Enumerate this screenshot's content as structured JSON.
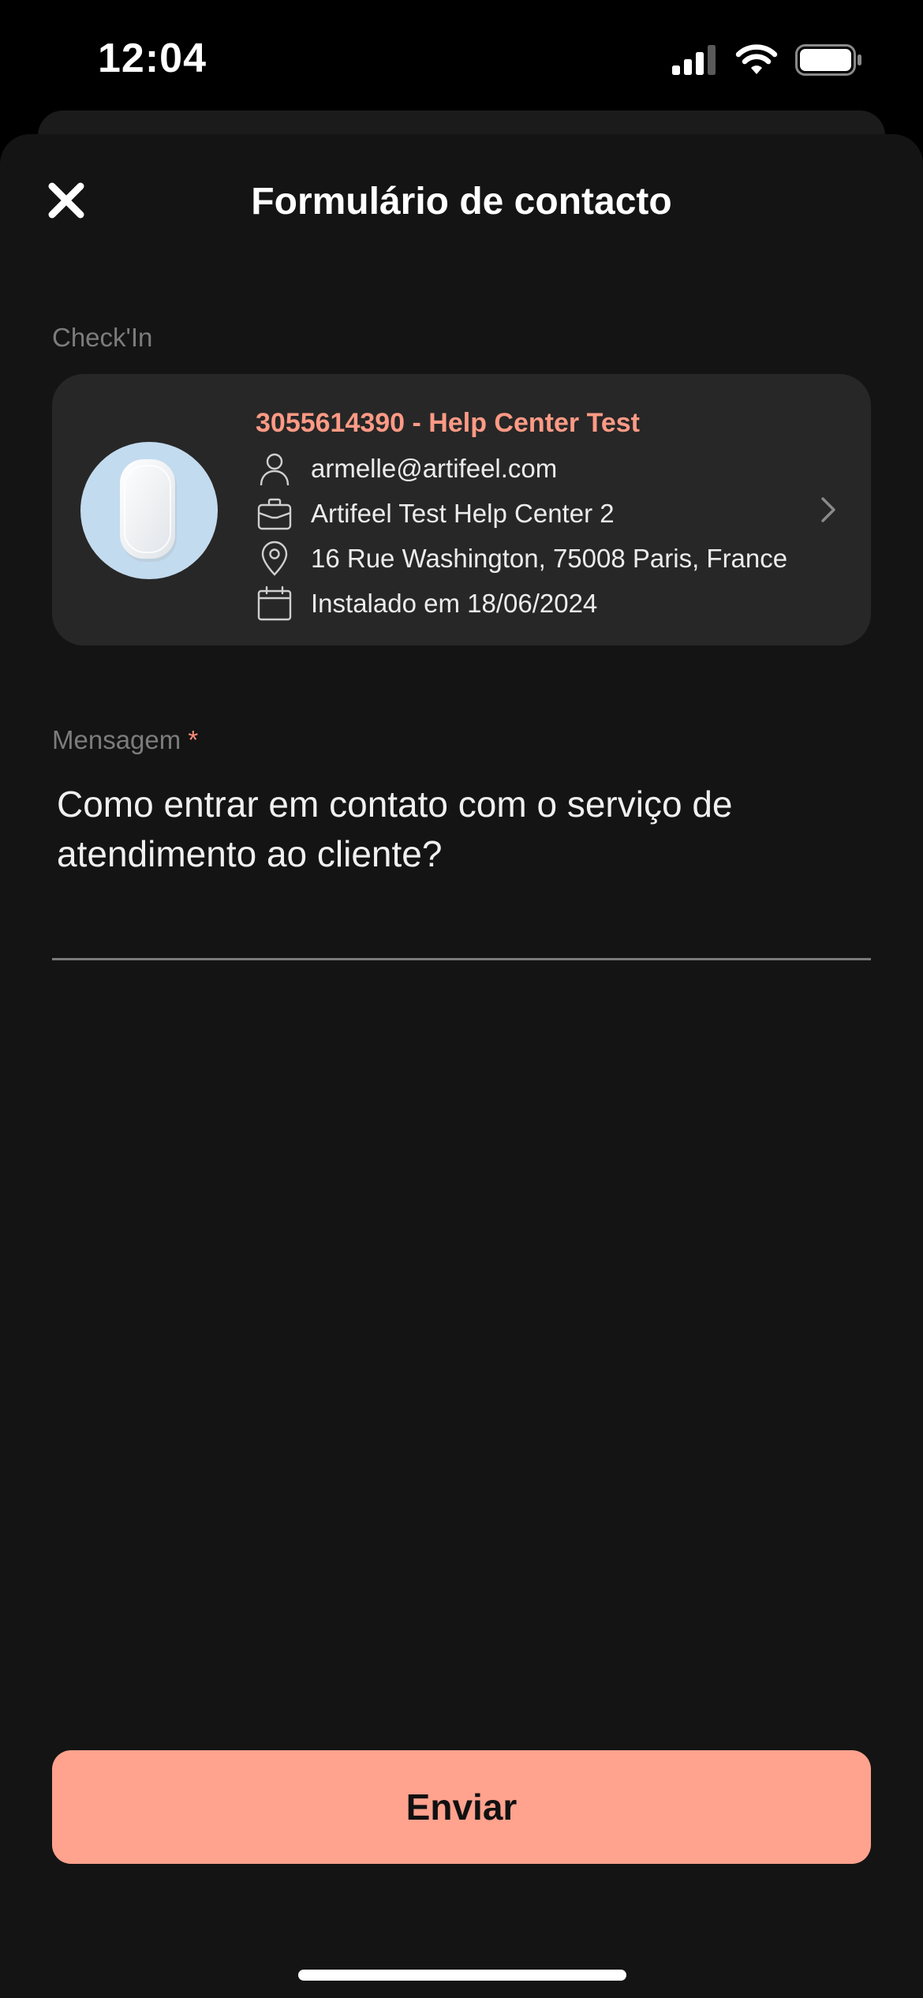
{
  "status_bar": {
    "time": "12:04",
    "icons": [
      "signal-icon",
      "wifi-icon",
      "battery-icon"
    ]
  },
  "header": {
    "title": "Formulário de contacto",
    "close_icon": "close-icon"
  },
  "checkin": {
    "label": "Check'In",
    "device_title": "3055614390 - Help Center Test",
    "email": "armelle@artifeel.com",
    "help_center": "Artifeel Test Help Center 2",
    "address": "16 Rue Washington, 75008 Paris, France",
    "installed": "Instalado em 18/06/2024",
    "icons": [
      "user-icon",
      "briefcase-icon",
      "location-pin-icon",
      "calendar-icon",
      "chevron-right-icon"
    ]
  },
  "message": {
    "label": "Mensagem",
    "required_marker": "*",
    "value": "Como entrar em contato com o serviço de atendimento ao cliente?"
  },
  "actions": {
    "submit_label": "Enviar"
  },
  "colors": {
    "background": "#000000",
    "sheet": "#141414",
    "card": "#272727",
    "accent": "#ffa28e",
    "accent_text": "#ff9a85",
    "muted_text": "#7c7c7c",
    "avatar_bg": "#c3dbef"
  }
}
